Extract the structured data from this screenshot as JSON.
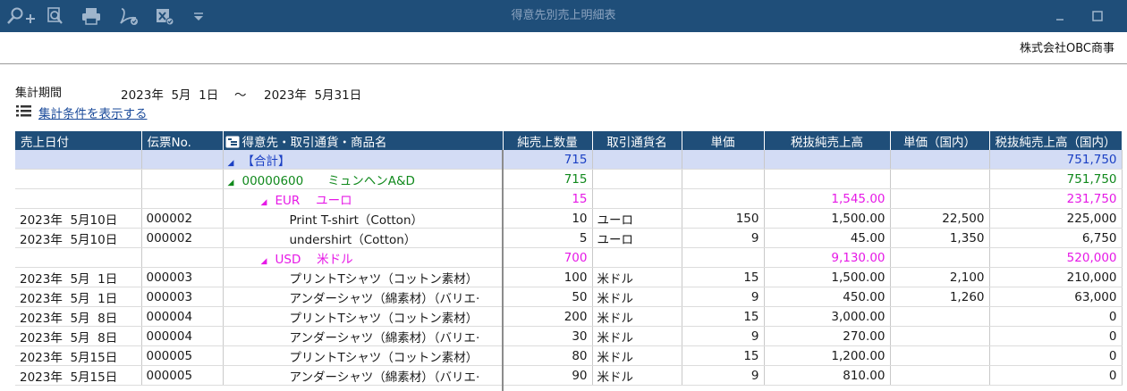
{
  "window": {
    "title": "得意先別売上明細表"
  },
  "toolbar": {
    "icons": [
      "zoom-in-icon",
      "magnify-search-icon",
      "print-icon",
      "pdf-export-icon",
      "excel-export-icon",
      "dropdown-icon"
    ]
  },
  "company": "株式会社OBC商事",
  "period": {
    "label": "集計期間",
    "from": "2023年  5月  1日",
    "tilde": "〜",
    "to": "2023年  5月31日"
  },
  "conditions_link": "集計条件を表示する",
  "table": {
    "headers": [
      "売上日付",
      "伝票No.",
      "得意先・取引通貨・商品名",
      "純売上数量",
      "取引通貨名",
      "単価",
      "税抜純売上高",
      "単価（国内）",
      "税抜純売上高（国内）"
    ],
    "total": {
      "name": "【合計】",
      "qty": "715",
      "amount_domestic": "751,750"
    },
    "customer": {
      "name": "00000600　　ミュンヘンA&D",
      "qty": "715",
      "amount_domestic": "751,750"
    },
    "groups": [
      {
        "currency": "EUR　 ユーロ",
        "qty": "15",
        "amount": "1,545.00",
        "amount_domestic": "231,750",
        "rows": [
          {
            "date": "2023年  5月10日",
            "no": "000002",
            "item": "Print T-shirt（Cotton）",
            "qty": "10",
            "currency": "ユーロ",
            "price": "150",
            "amount": "1,500.00",
            "price_domestic": "22,500",
            "amount_domestic": "225,000"
          },
          {
            "date": "2023年  5月10日",
            "no": "000002",
            "item": "undershirt（Cotton）",
            "qty": "5",
            "currency": "ユーロ",
            "price": "9",
            "amount": "45.00",
            "price_domestic": "1,350",
            "amount_domestic": "6,750"
          }
        ]
      },
      {
        "currency": "USD　 米ドル",
        "qty": "700",
        "amount": "9,130.00",
        "amount_domestic": "520,000",
        "rows": [
          {
            "date": "2023年  5月  1日",
            "no": "000003",
            "item": "プリントTシャツ（コットン素材）",
            "qty": "100",
            "currency": "米ドル",
            "price": "15",
            "amount": "1,500.00",
            "price_domestic": "2,100",
            "amount_domestic": "210,000"
          },
          {
            "date": "2023年  5月  1日",
            "no": "000003",
            "item": "アンダーシャツ（綿素材）（バリエ·",
            "qty": "50",
            "currency": "米ドル",
            "price": "9",
            "amount": "450.00",
            "price_domestic": "1,260",
            "amount_domestic": "63,000"
          },
          {
            "date": "2023年  5月  8日",
            "no": "000004",
            "item": "プリントTシャツ（コットン素材）",
            "qty": "200",
            "currency": "米ドル",
            "price": "15",
            "amount": "3,000.00",
            "price_domestic": "",
            "amount_domestic": "0"
          },
          {
            "date": "2023年  5月  8日",
            "no": "000004",
            "item": "アンダーシャツ（綿素材）（バリエ·",
            "qty": "30",
            "currency": "米ドル",
            "price": "9",
            "amount": "270.00",
            "price_domestic": "",
            "amount_domestic": "0"
          },
          {
            "date": "2023年  5月15日",
            "no": "000005",
            "item": "プリントTシャツ（コットン素材）",
            "qty": "80",
            "currency": "米ドル",
            "price": "15",
            "amount": "1,200.00",
            "price_domestic": "",
            "amount_domestic": "0"
          },
          {
            "date": "2023年  5月15日",
            "no": "000005",
            "item": "アンダーシャツ（綿素材）（バリエ·",
            "qty": "90",
            "currency": "米ドル",
            "price": "9",
            "amount": "810.00",
            "price_domestic": "",
            "amount_domestic": "0"
          }
        ]
      }
    ]
  },
  "colors": {
    "titlebar": "#1f4e79",
    "total_row_bg": "#d3dcf5",
    "total_text": "#1a3fc4",
    "customer_text": "#10891c",
    "currency_text": "#e619e6",
    "link": "#1a4a9a"
  }
}
